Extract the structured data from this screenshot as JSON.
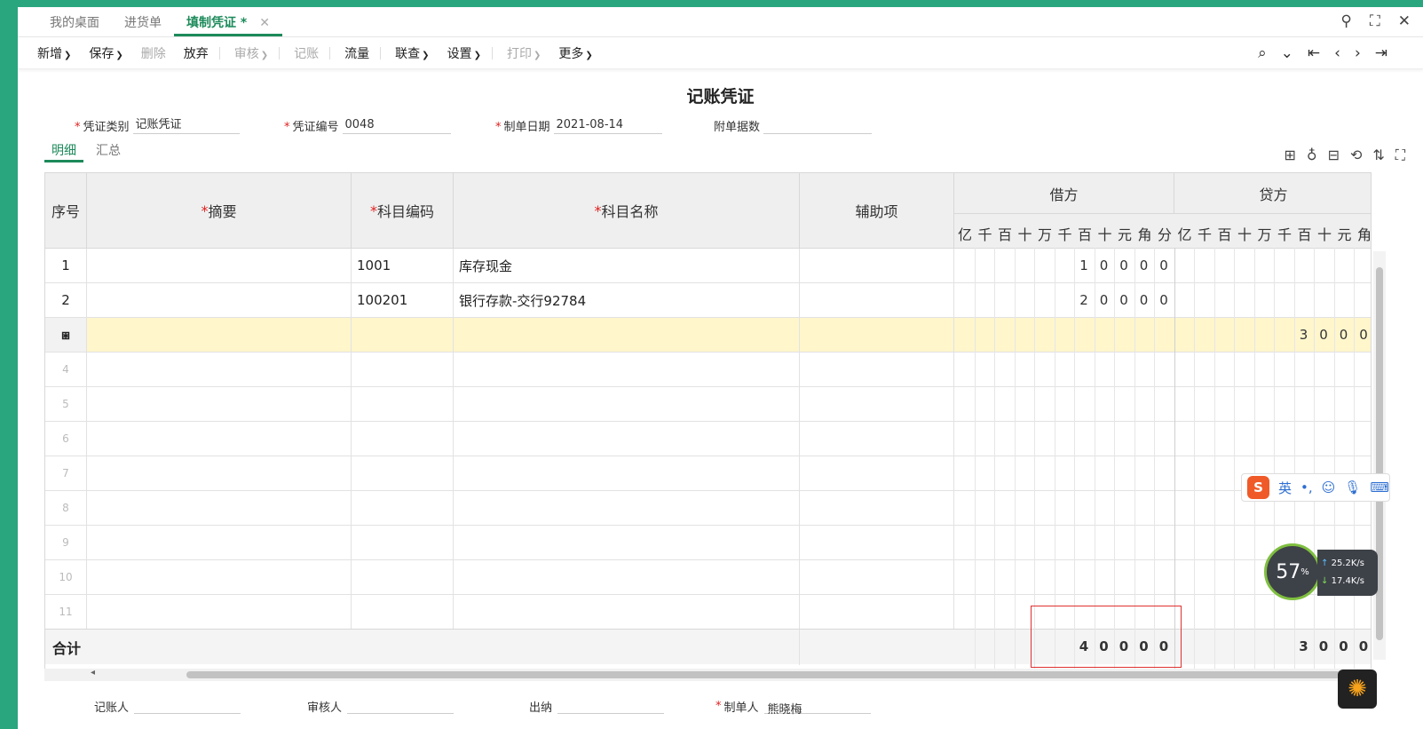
{
  "tabs": [
    {
      "label": "我的桌面",
      "active": false
    },
    {
      "label": "进货单",
      "active": false
    },
    {
      "label": "填制凭证 *",
      "active": true
    }
  ],
  "toolbar": {
    "new": "新增",
    "save": "保存",
    "delete": "删除",
    "abandon": "放弃",
    "review": "审核",
    "post": "记账",
    "flow": "流量",
    "query": "联查",
    "settings": "设置",
    "print": "打印",
    "more": "更多"
  },
  "title": "记账凭证",
  "meta": {
    "category_label": "凭证类别",
    "category_value": "记账凭证",
    "number_label": "凭证编号",
    "number_value": "0048",
    "date_label": "制单日期",
    "date_value": "2021-08-14",
    "attach_label": "附单据数",
    "attach_value": ""
  },
  "subtabs": [
    "明细",
    "汇总"
  ],
  "headers": {
    "seq": "序号",
    "summary": "摘要",
    "code": "科目编码",
    "name": "科目名称",
    "aux": "辅助项",
    "debit": "借方",
    "credit": "贷方",
    "units": [
      "亿",
      "千",
      "百",
      "十",
      "万",
      "千",
      "百",
      "十",
      "元",
      "角",
      "分"
    ],
    "credit_units": [
      "亿",
      "千",
      "百",
      "十",
      "万",
      "千",
      "百",
      "十",
      "元",
      "角"
    ]
  },
  "rows": [
    {
      "seq": "1",
      "summary": "",
      "code": "1001",
      "name": "库存现金",
      "debit": [
        "1",
        "0",
        "0",
        "0",
        "0"
      ],
      "credit": []
    },
    {
      "seq": "2",
      "summary": "",
      "code": "100201",
      "name": "银行存款-交行92784",
      "debit": [
        "2",
        "0",
        "0",
        "0",
        "0"
      ],
      "credit": []
    },
    {
      "seq": "⧆",
      "summary": "",
      "code": "",
      "name": "",
      "debit": [],
      "credit": [
        "3",
        "0",
        "0",
        "0"
      ]
    },
    {
      "seq": "4"
    },
    {
      "seq": "5"
    },
    {
      "seq": "6"
    },
    {
      "seq": "7"
    },
    {
      "seq": "8"
    },
    {
      "seq": "9"
    },
    {
      "seq": "10"
    },
    {
      "seq": "11"
    }
  ],
  "total": {
    "label": "合计",
    "debit": [
      "4",
      "0",
      "0",
      "0",
      "0"
    ],
    "credit": [
      "3",
      "0",
      "0",
      "0"
    ]
  },
  "footer": {
    "poster_label": "记账人",
    "poster_value": "",
    "reviewer_label": "审核人",
    "reviewer_value": "",
    "cashier_label": "出纳",
    "cashier_value": "",
    "maker_label": "制单人",
    "maker_value": "熊晓梅"
  },
  "ime": {
    "lang": "英"
  },
  "netmon": {
    "percent": "57",
    "percent_unit": "%",
    "up": "25.2",
    "down": "17.4",
    "unit": "K/s"
  },
  "colors": {
    "accent": "#1c8a5a",
    "highlight_row": "#fff6cc",
    "required": "#e02020",
    "frame": "#2aa67e"
  }
}
